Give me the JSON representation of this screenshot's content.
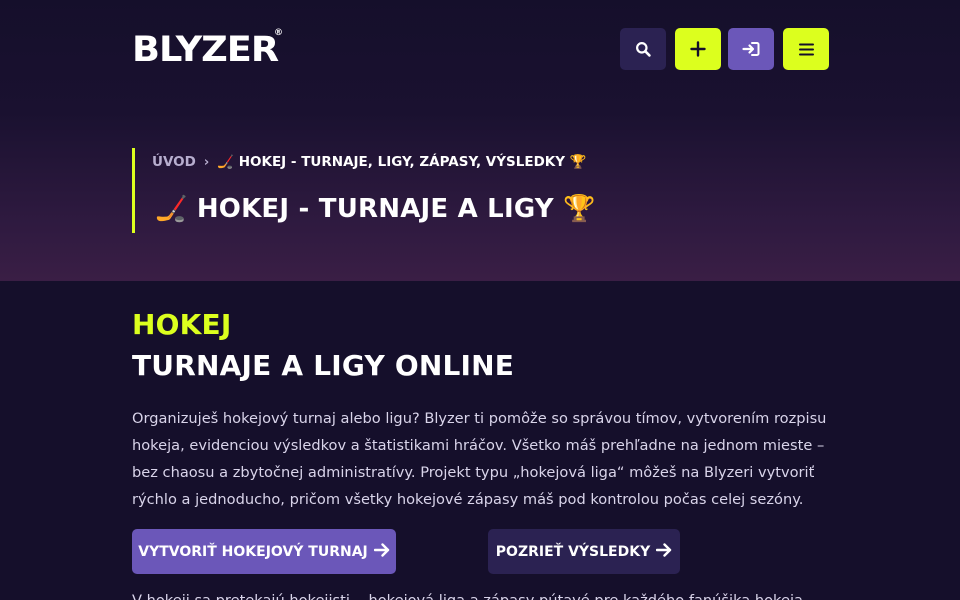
{
  "header": {
    "logo": "BLYZER",
    "logo_mark": "®",
    "icons": {
      "search": "search-icon",
      "add": "plus-icon",
      "login": "login-icon",
      "menu": "hamburger-menu-icon"
    }
  },
  "breadcrumb": {
    "home": "ÚVOD",
    "separator": "›",
    "current": "🏒 HOKEJ - TURNAJE, LIGY, ZÁPASY, VÝSLEDKY 🏆"
  },
  "hero": {
    "title": "🏒 HOKEJ - TURNAJE A LIGY 🏆"
  },
  "section": {
    "kicker": "HOKEJ",
    "title": "TURNAJE A LIGY ONLINE",
    "intro": "Organizuješ hokejový turnaj alebo ligu? Blyzer ti pomôže so správou tímov, vytvorením rozpisu hokeja, evidenciou výsledkov a štatistikami hráčov. Všetko máš prehľadne na jednom mieste – bez chaosu a zbytočnej administratívy. Projekt typu „hokejová liga“ môžeš na Blyzeri vytvoriť rýchlo a jednoducho, pričom všetky hokejové zápasy máš pod kontrolou počas celej sezóny.",
    "cta_primary": "VYTVORIŤ HOKEJOVÝ TURNAJ",
    "cta_secondary": "POZRIEŤ VÝSLEDKY",
    "next_line": "V hokeji sa pretekajú hokejisti... hokejová liga a zápasy pútavé pre každého fanúšika hokeja."
  },
  "colors": {
    "background": "#150f2b",
    "accent_lime": "#dcff1e",
    "accent_purple": "#6b57b9",
    "button_dark": "#2b2252"
  }
}
